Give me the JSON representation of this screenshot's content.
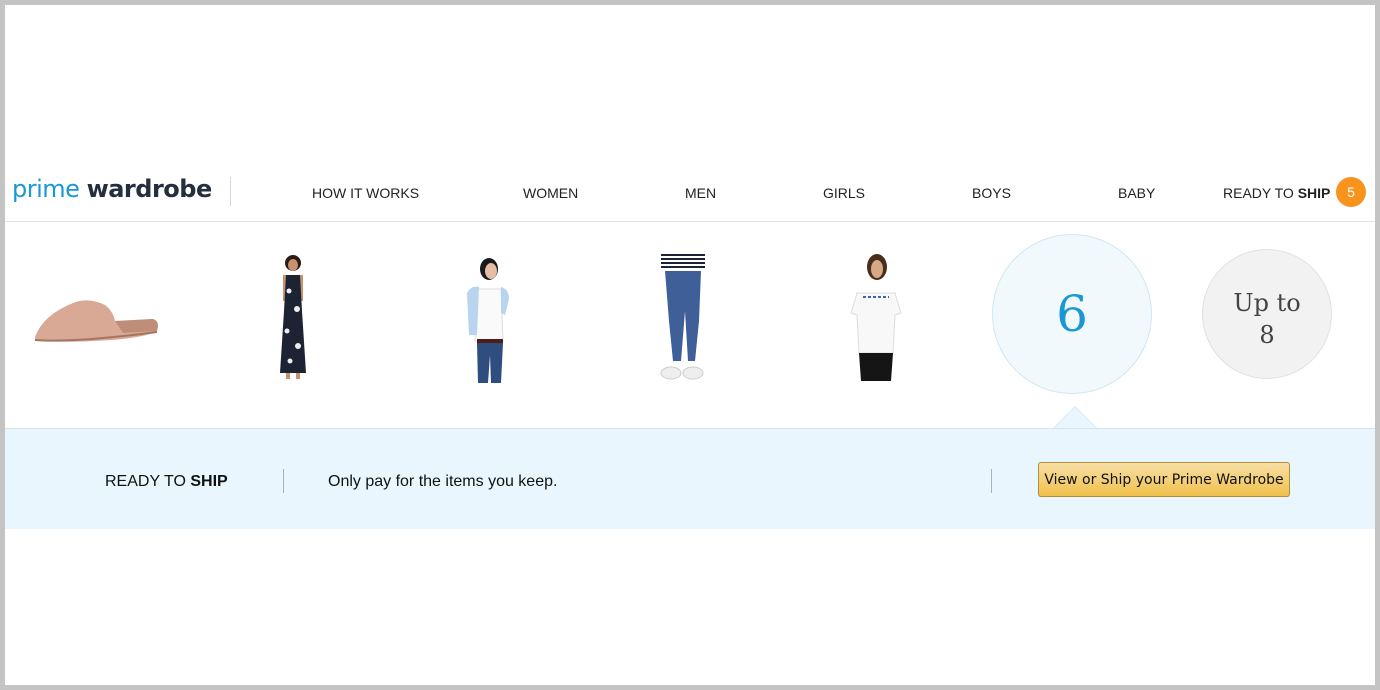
{
  "header": {
    "logo": {
      "part1": "prime",
      "part2": "wardrobe"
    },
    "nav": [
      {
        "label": "HOW IT WORKS"
      },
      {
        "label": "WOMEN"
      },
      {
        "label": "MEN"
      },
      {
        "label": "GIRLS"
      },
      {
        "label": "BOYS"
      },
      {
        "label": "BABY"
      }
    ],
    "ready_to_ship": {
      "prefix": "READY TO ",
      "bold": "SHIP",
      "count": "5"
    }
  },
  "items": [
    {
      "name": "pink knit mule slipper"
    },
    {
      "name": "navy floral maxi dress"
    },
    {
      "name": "light blue cardigan"
    },
    {
      "name": "skinny blue jeans"
    },
    {
      "name": "white embroidered peasant top"
    }
  ],
  "slots": {
    "current_count": "6",
    "max_line1": "Up to",
    "max_line2": "8"
  },
  "banner": {
    "label_prefix": "READY TO ",
    "label_bold": "SHIP",
    "text": "Only pay for the items you keep.",
    "button_label": "View or Ship your Prime Wardrobe"
  },
  "colors": {
    "brand_blue": "#1a98d5",
    "badge_orange": "#f7941d",
    "banner_bg": "#eaf6fd",
    "button_gold": "#f0c14b"
  }
}
